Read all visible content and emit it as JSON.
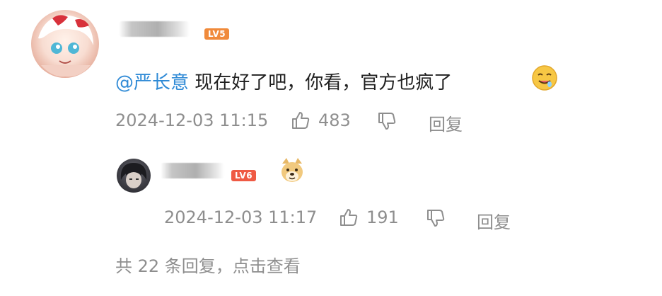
{
  "comment": {
    "level_badge": "LV5",
    "mention": "@严长意",
    "text": " 现在好了吧，你看，官方也疯了",
    "emoji_name": "drooling-face-emoji",
    "timestamp": "2024-12-03 11:15",
    "like_count": "483",
    "reply_label": "回复"
  },
  "reply": {
    "level_badge": "LV6",
    "sticker_name": "doge-sticker",
    "timestamp": "2024-12-03 11:17",
    "like_count": "191",
    "reply_label": "回复"
  },
  "footer": {
    "replies_summary": "共 22 条回复，点击查看"
  },
  "colors": {
    "mention_blue": "#2f8ad6",
    "meta_gray": "#8e8e8e",
    "lv5_badge": "#f08a3b",
    "lv6_badge": "#ef5a44"
  }
}
